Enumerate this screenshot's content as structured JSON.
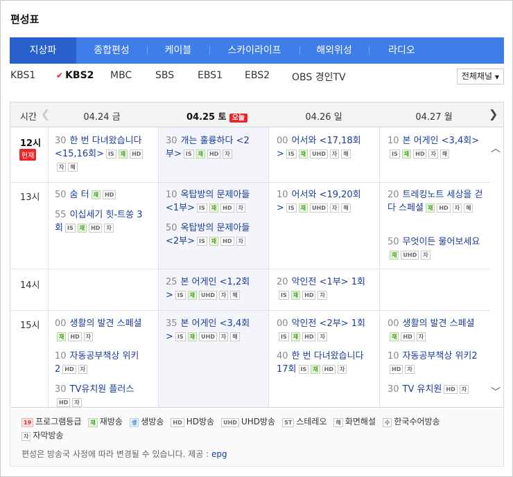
{
  "title": "편성표",
  "tabs": [
    "지상파",
    "종합편성",
    "케이블",
    "스카이라이프",
    "해외위성",
    "라디오"
  ],
  "channels": [
    "KBS1",
    "KBS2",
    "MBC",
    "SBS",
    "EBS1",
    "EBS2",
    "OBS 경인TV"
  ],
  "selected_channel": "KBS2",
  "all_channels_label": "전체채널",
  "time_label": "시간",
  "dates": [
    {
      "label": "04.24 금"
    },
    {
      "label": "04.25 토",
      "today": "오늘"
    },
    {
      "label": "04.26 일"
    },
    {
      "label": "04.27 월"
    }
  ],
  "hours": [
    {
      "label": "12시",
      "now_badge": "현재"
    },
    {
      "label": "13시"
    },
    {
      "label": "14시"
    },
    {
      "label": "15시"
    }
  ],
  "badges": {
    "IS": "IS",
    "re": "재",
    "HD": "HD",
    "UHD": "UHD",
    "sub": "자",
    "desc": "해"
  },
  "programs": [
    {
      "min": "30",
      "title": "한 번 다녀왔습니다 <15,16회>",
      "badges": [
        "IS",
        "재",
        "HD",
        "자",
        "해"
      ]
    },
    {
      "min": "30",
      "title": "개는 훌륭하다 <2부>",
      "badges": [
        "IS",
        "재",
        "HD",
        "자"
      ]
    },
    {
      "min": "00",
      "title": "어서와 <17,18회>",
      "badges": [
        "IS",
        "재",
        "UHD",
        "자",
        "해"
      ]
    },
    {
      "min": "10",
      "title": "본 어게인 <3,4회>",
      "badges": [
        "IS",
        "재",
        "HD",
        "자",
        "해"
      ]
    },
    {
      "min": "50",
      "title": "숨 터",
      "badges": [
        "재",
        "HD"
      ]
    },
    {
      "min": "55",
      "title": "이십세기 힛-트쏭 3회",
      "badges": [
        "IS",
        "재",
        "HD",
        "자"
      ]
    },
    {
      "min": "10",
      "title": "옥탑방의 문제아들 <1부>",
      "badges": [
        "IS",
        "재",
        "HD",
        "자"
      ]
    },
    {
      "min": "50",
      "title": "옥탑방의 문제아들 <2부>",
      "badges": [
        "IS",
        "재",
        "HD",
        "자"
      ]
    },
    {
      "min": "10",
      "title": "어서와 <19,20회>",
      "badges": [
        "IS",
        "재",
        "UHD",
        "자",
        "해"
      ]
    },
    {
      "min": "20",
      "title": "트레킹노트 세상을 걷다 스페셜",
      "badges": [
        "재",
        "HD",
        "자",
        "해"
      ]
    },
    {
      "min": "50",
      "title": "무엇이든 물어보세요",
      "badges": [
        "재",
        "UHD",
        "자"
      ]
    },
    {
      "min": "25",
      "title": "본 어게인 <1,2회>",
      "badges": [
        "IS",
        "재",
        "UHD",
        "자",
        "해"
      ]
    },
    {
      "min": "20",
      "title": "악인전 <1부> 1회",
      "badges": [
        "IS",
        "재",
        "HD",
        "자"
      ]
    },
    {
      "min": "00",
      "title": "생활의 발견 스페셜",
      "badges": [
        "재",
        "HD",
        "자"
      ]
    },
    {
      "min": "10",
      "title": "자동공부책상 위키2",
      "badges": [
        "HD",
        "자"
      ]
    },
    {
      "min": "30",
      "title": "TV유치원 플러스",
      "badges": [
        "HD",
        "자"
      ]
    },
    {
      "min": "35",
      "title": "본 어게인 <3,4회>",
      "badges": [
        "IS",
        "재",
        "UHD",
        "자",
        "해"
      ]
    },
    {
      "min": "00",
      "title": "악인전 <2부> 1회",
      "badges": [
        "IS",
        "재",
        "HD",
        "자"
      ]
    },
    {
      "min": "40",
      "title": "한 번 다녀왔습니다 17회",
      "badges": [
        "IS",
        "재",
        "HD",
        "자"
      ]
    },
    {
      "min": "00",
      "title": "생활의 발견 스페셜",
      "badges": [
        "재",
        "HD",
        "자"
      ]
    },
    {
      "min": "10",
      "title": "자동공부책상 위키2",
      "badges": [
        "HD",
        "자"
      ]
    },
    {
      "min": "30",
      "title": "TV 유치원",
      "badges": [
        "HD",
        "자"
      ]
    }
  ],
  "legend": [
    {
      "badge": "19",
      "label": "프로그램등급",
      "kind": "age"
    },
    {
      "badge": "재",
      "label": "재방송",
      "kind": "re"
    },
    {
      "badge": "생",
      "label": "생방송",
      "kind": "live"
    },
    {
      "badge": "HD",
      "label": "HD방송",
      "kind": ""
    },
    {
      "badge": "UHD",
      "label": "UHD방송",
      "kind": ""
    },
    {
      "badge": "ST",
      "label": "스테레오",
      "kind": ""
    },
    {
      "badge": "해",
      "label": "화면해설",
      "kind": ""
    },
    {
      "badge": "수",
      "label": "한국수어방송",
      "kind": ""
    },
    {
      "badge": "자",
      "label": "자막방송",
      "kind": ""
    }
  ],
  "note": "편성은 방송국 사정에 따라 변경될 수 있습니다. 제공 : ",
  "provider": "epg"
}
